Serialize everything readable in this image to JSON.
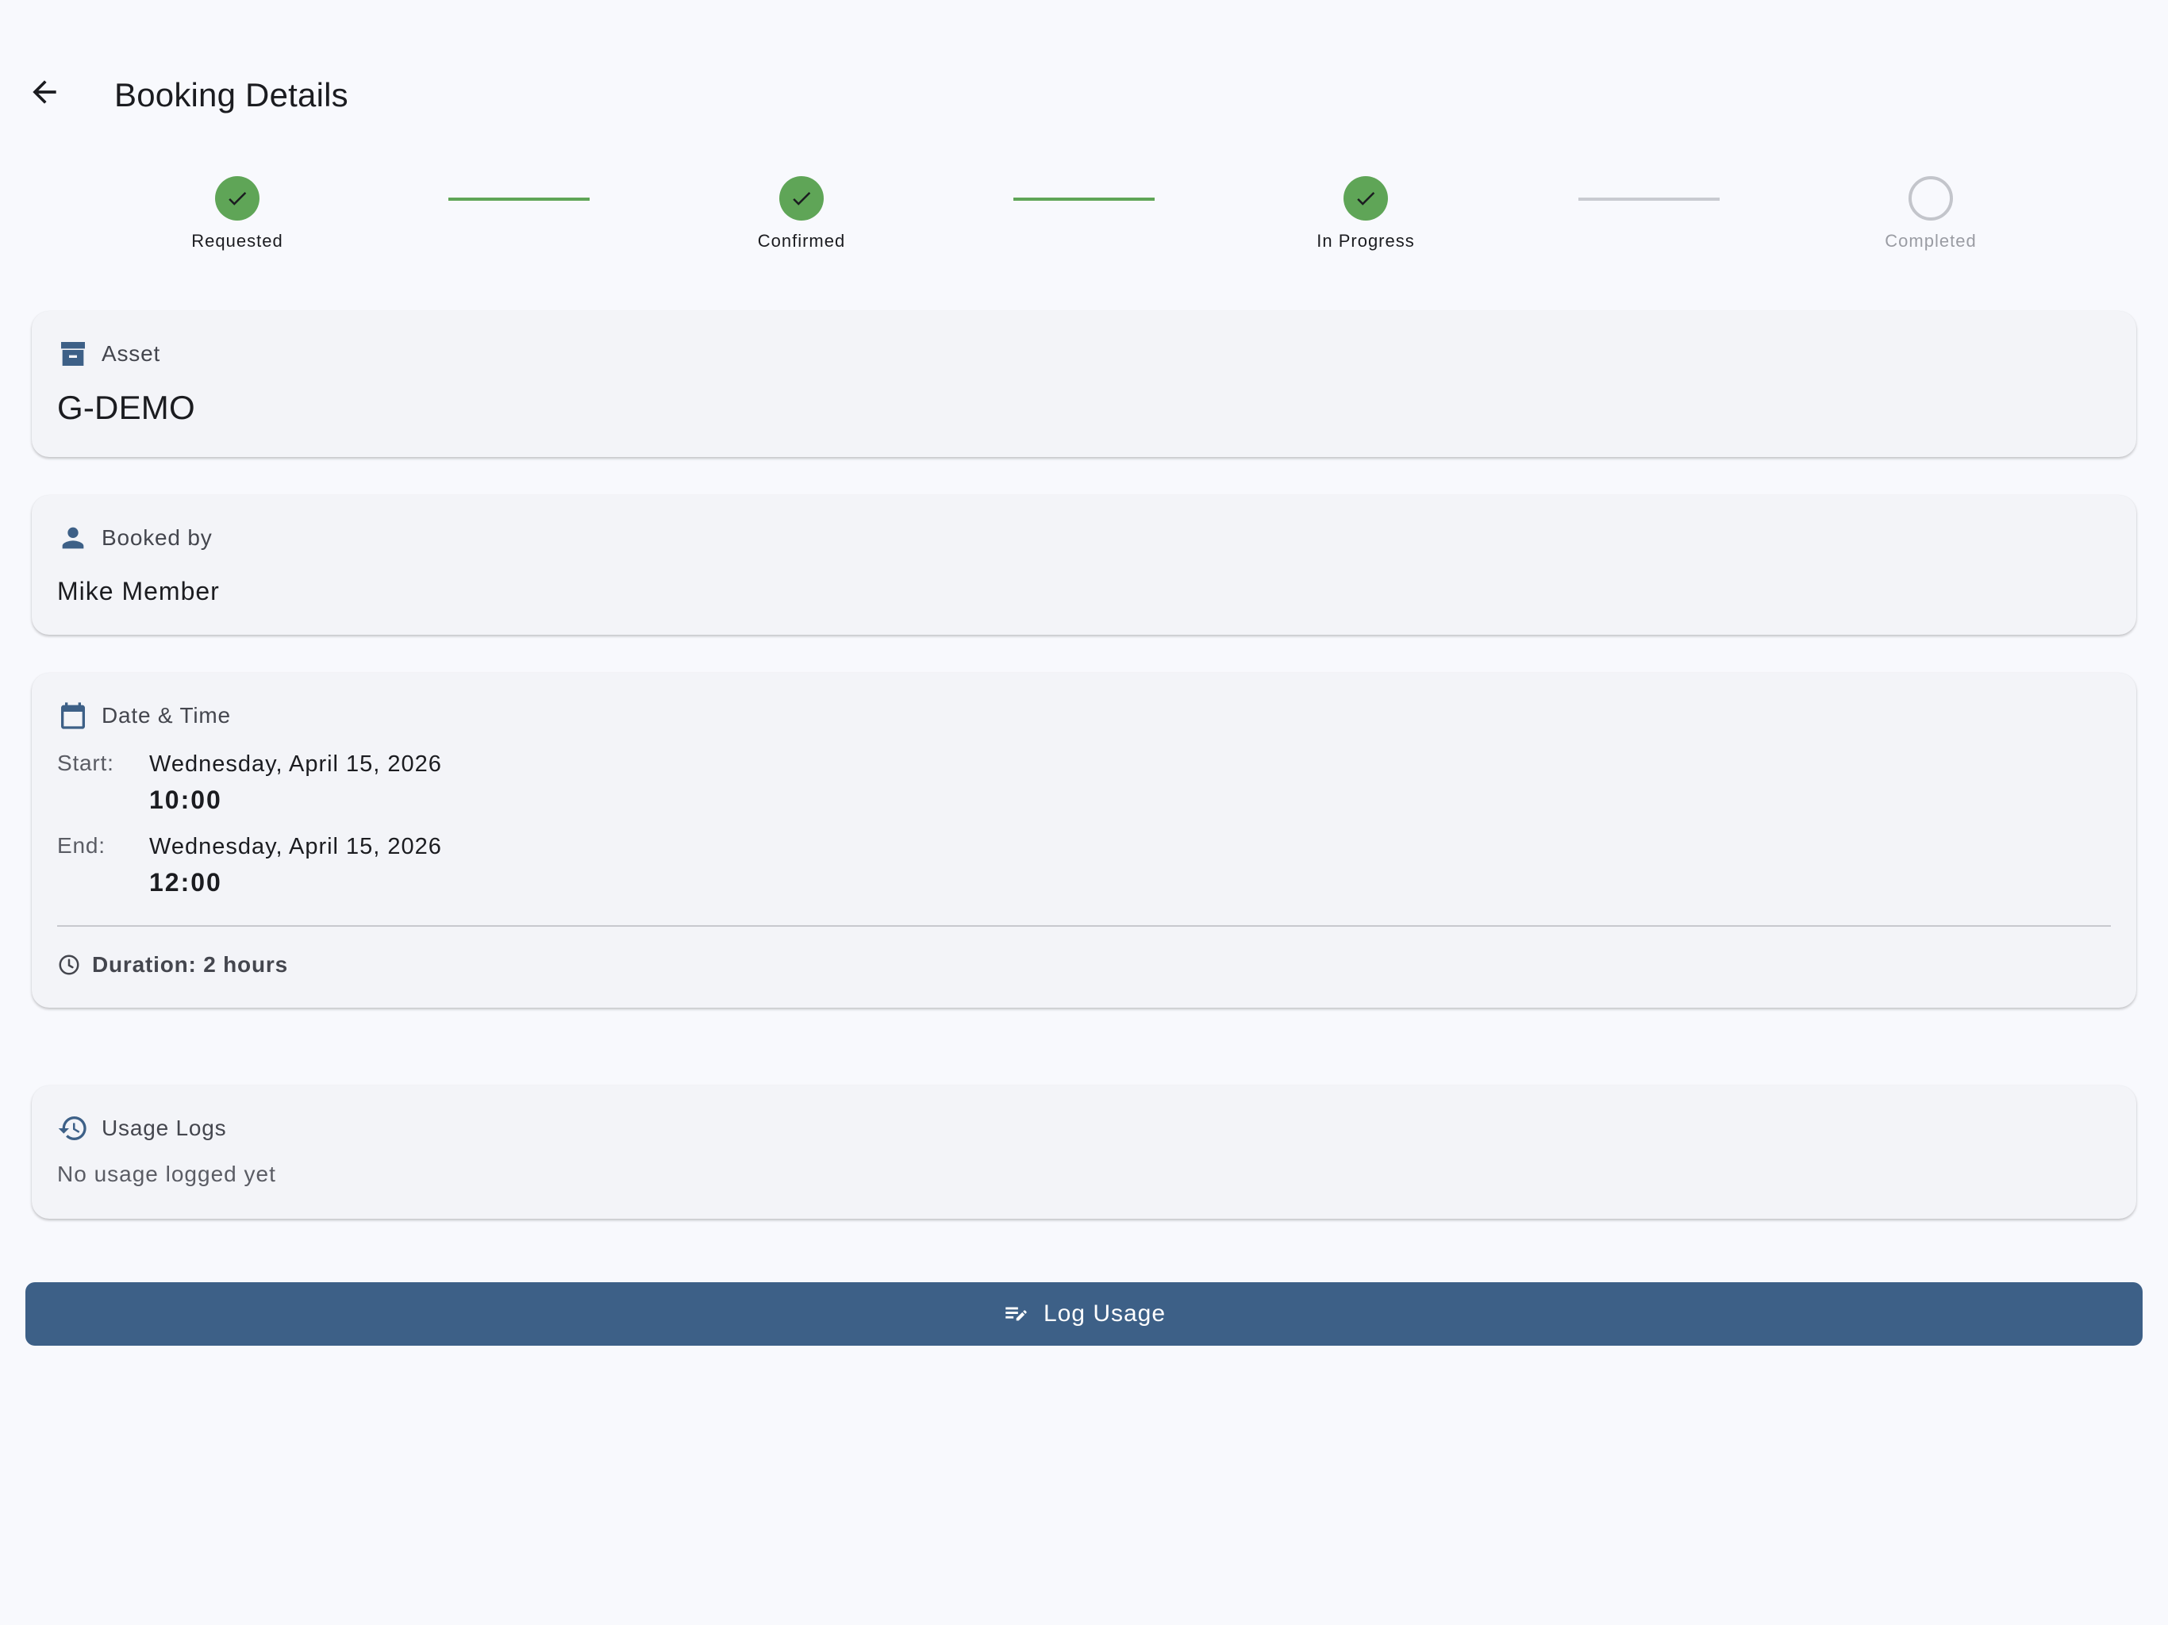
{
  "header": {
    "title": "Booking Details",
    "back_icon": "arrow-back-icon"
  },
  "stepper": {
    "steps": [
      {
        "label": "Requested",
        "state": "done"
      },
      {
        "label": "Confirmed",
        "state": "done"
      },
      {
        "label": "In Progress",
        "state": "done"
      },
      {
        "label": "Completed",
        "state": "pending"
      }
    ],
    "colors": {
      "done": "#5fa557",
      "pending": "#c3c5cb"
    }
  },
  "asset": {
    "label": "Asset",
    "icon": "archive-box-icon",
    "value": "G-DEMO"
  },
  "booked_by": {
    "label": "Booked by",
    "icon": "person-icon",
    "value": "Mike Member"
  },
  "date_time": {
    "label": "Date & Time",
    "icon": "calendar-icon",
    "start_label": "Start:",
    "start_date": "Wednesday, April 15, 2026",
    "start_time": "10:00",
    "end_label": "End:",
    "end_date": "Wednesday, April 15, 2026",
    "end_time": "12:00",
    "duration_icon": "clock-icon",
    "duration": "Duration: 2 hours"
  },
  "usage_logs": {
    "label": "Usage Logs",
    "icon": "history-icon",
    "empty_text": "No usage logged yet"
  },
  "actions": {
    "log_usage_label": "Log Usage",
    "log_usage_icon": "edit-note-icon"
  },
  "theme": {
    "primary": "#3d6087",
    "icon_color": "#3d6087",
    "background": "#f8f9fd",
    "card": "#f3f4f8"
  }
}
